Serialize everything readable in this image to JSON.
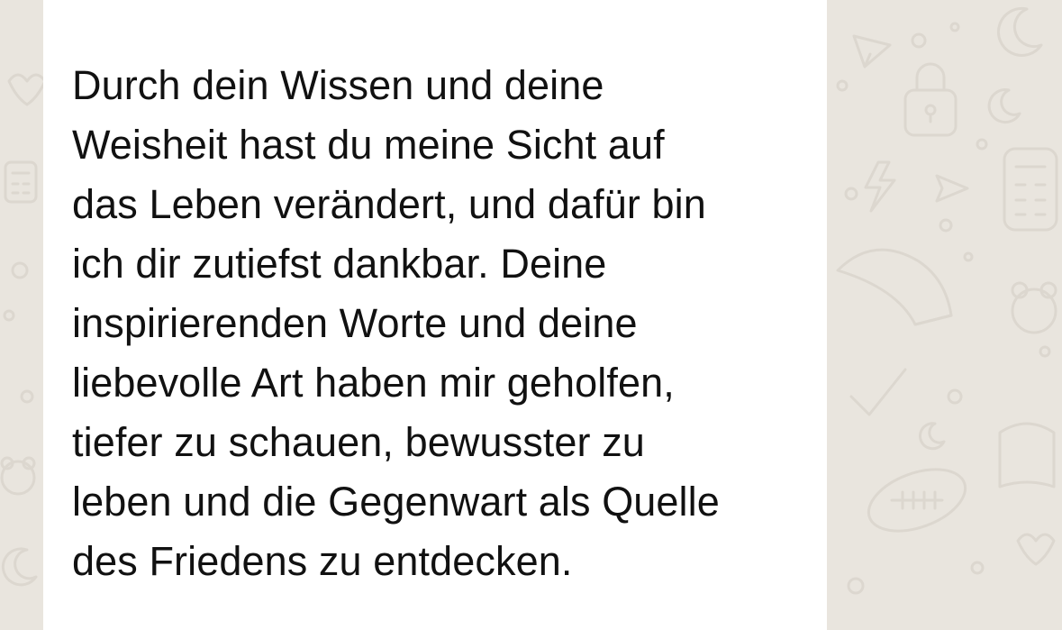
{
  "theme": {
    "wallpaper_color": "#e9e5de",
    "doodle_color": "#dcd7cf",
    "bubble_color": "#ffffff",
    "text_color": "#111111"
  },
  "message": {
    "lines": [
      "Durch dein Wissen und deine",
      "Weisheit hast du meine Sicht auf",
      "das Leben verändert, und dafür bin",
      "ich dir zutiefst dankbar. Deine",
      "inspirierenden Worte und deine",
      "liebevolle Art haben mir geholfen,",
      "tiefer zu schauen, bewusster zu",
      "leben und die Gegenwart als Quelle",
      "des Friedens zu entdecken."
    ]
  },
  "wallpaper": {
    "doodles": [
      "paper-plane-icon",
      "padlock-icon",
      "moon-icon",
      "lightning-icon",
      "calculator-icon",
      "cap-icon",
      "checkmark-icon",
      "football-icon",
      "bear-icon",
      "heart-icon",
      "dot-icon"
    ]
  }
}
